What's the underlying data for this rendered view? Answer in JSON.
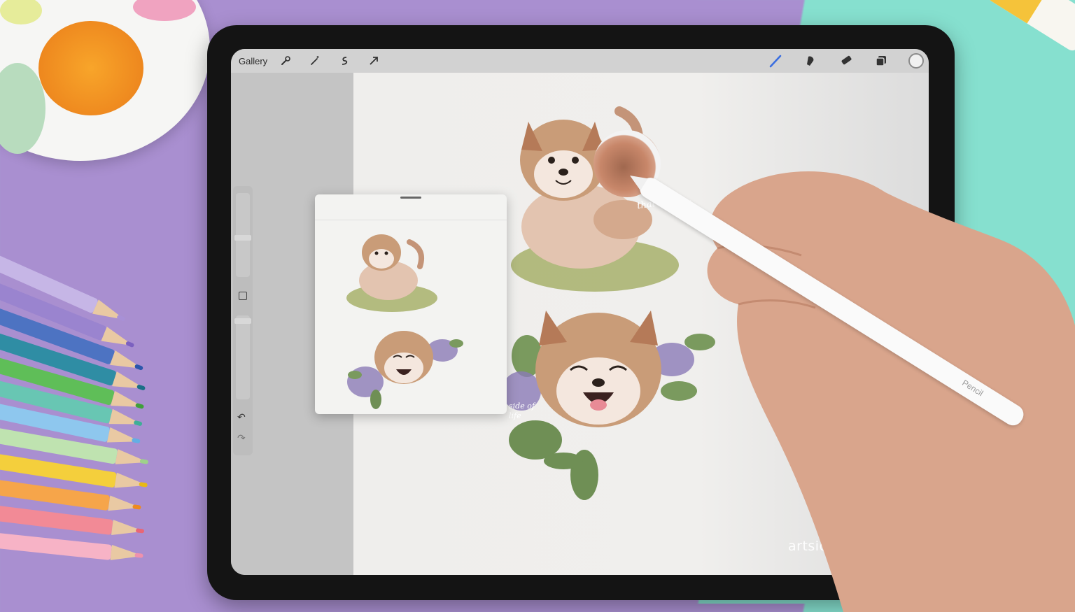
{
  "toolbar": {
    "gallery_label": "Gallery",
    "icons": [
      "wrench-icon",
      "magic-wand-icon",
      "selection-icon",
      "transform-arrow-icon",
      "brush-icon",
      "smudge-icon",
      "eraser-icon",
      "layers-icon",
      "color-circle-icon"
    ]
  },
  "sidebar": {
    "icons": [
      "undo-icon",
      "redo-icon",
      "modify-square-icon"
    ]
  },
  "canvas": {
    "lettering_top": "that's life ...",
    "lettering_bottom": "side of life"
  },
  "stylus_brand": "Pencil",
  "watermark": "artsideoflife.com",
  "colors": {
    "background_purple": "#a98fd0",
    "background_teal": "#86e0cf",
    "ipad_bezel": "#141414",
    "toolbar": "#d2d2d2",
    "sampled_color": "#a0684f"
  }
}
